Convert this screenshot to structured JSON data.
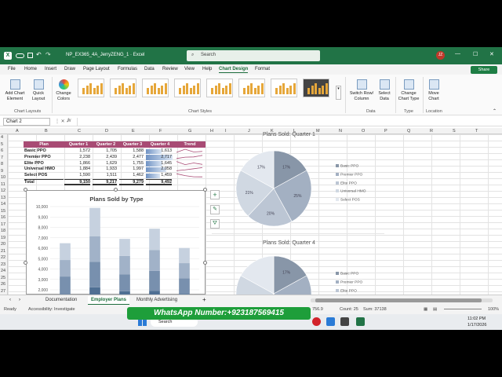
{
  "window": {
    "filename": "NP_EX365_4A_JerryZENG_1 · Excel",
    "search_placeholder": "Search",
    "user_initials": "JZ",
    "share_label": "Share"
  },
  "menu": [
    "File",
    "Home",
    "Insert",
    "Draw",
    "Page Layout",
    "Formulas",
    "Data",
    "Review",
    "View",
    "Help",
    "Chart Design",
    "Format"
  ],
  "menu_active": "Chart Design",
  "ribbon": {
    "add_chart_element": "Add Chart Element",
    "quick_layout": "Quick Layout",
    "change_colors": "Change Colors",
    "chart_layouts_label": "Chart Layouts",
    "chart_styles_label": "Chart Styles",
    "switch_row_col": "Switch Row/ Column",
    "select_data": "Select Data",
    "data_label": "Data",
    "change_chart_type": "Change Chart Type",
    "type_label": "Type",
    "move_chart": "Move Chart",
    "location_label": "Location"
  },
  "formula_bar": {
    "name_box": "Chart 2",
    "fx": "fx",
    "value": ""
  },
  "columns": [
    "A",
    "B",
    "C",
    "D",
    "E",
    "F",
    "G",
    "H",
    "I",
    "J",
    "K",
    "L",
    "M",
    "N",
    "O",
    "P",
    "Q",
    "R",
    "S",
    "T"
  ],
  "rows": [
    "4",
    "5",
    "6",
    "7",
    "8",
    "9",
    "10",
    "11",
    "12",
    "13",
    "14",
    "15",
    "16",
    "17",
    "18",
    "19",
    "20",
    "21",
    "22",
    "23",
    "24",
    "25",
    "26",
    "27"
  ],
  "table": {
    "headers": [
      "Plan",
      "Quarter 1",
      "Quarter 2",
      "Quarter 3",
      "Quarter 4",
      "Trend"
    ],
    "rows": [
      {
        "plan": "Basic PPO",
        "q1": "1,572",
        "q2": "1,705",
        "q3": "1,588",
        "q4": "1,613"
      },
      {
        "plan": "Premier PPO",
        "q1": "2,238",
        "q2": "2,439",
        "q3": "2,477",
        "q4": "2,717"
      },
      {
        "plan": "Elite PPO",
        "q1": "1,866",
        "q2": "1,629",
        "q3": "1,755",
        "q4": "1,645"
      },
      {
        "plan": "Universal HMO",
        "q1": "1,884",
        "q2": "1,933",
        "q3": "1,997",
        "q4": "2,058"
      },
      {
        "plan": "Select POS",
        "q1": "1,590",
        "q2": "1,511",
        "q3": "1,462",
        "q4": "1,459"
      },
      {
        "plan": "Total",
        "q1": "9,150",
        "q2": "9,217",
        "q3": "9,279",
        "q4": "9,492"
      }
    ]
  },
  "chart_data": [
    {
      "type": "bar",
      "stacked": true,
      "title": "Plans Sold by Type",
      "ylim": [
        0,
        10000
      ],
      "yticks": [
        "10,000",
        "9,000",
        "8,000",
        "7,000",
        "6,000",
        "5,000",
        "4,000",
        "3,000",
        "2,000"
      ],
      "series": [
        {
          "values": [
            1572,
            2238,
            1866,
            1884,
            1590
          ]
        },
        {
          "values": [
            1705,
            2439,
            1629,
            1933,
            1511
          ]
        },
        {
          "values": [
            1588,
            2477,
            1755,
            1997,
            1462
          ]
        },
        {
          "values": [
            1613,
            2717,
            1645,
            2058,
            1459
          ]
        }
      ],
      "colors": [
        "#4f6f93",
        "#7890ae",
        "#a1b2c8",
        "#c6d1df"
      ]
    },
    {
      "type": "pie",
      "title": "Plans Sold: Quarter 1",
      "categories": [
        "Basic PPO",
        "Premier PPO",
        "Elite PPO",
        "Universal HMO",
        "Select POS"
      ],
      "values": [
        17,
        25,
        20,
        21,
        17
      ],
      "labels": [
        "17%",
        "25%",
        "20%",
        "21%",
        "17%"
      ]
    },
    {
      "type": "pie",
      "title": "Plans Sold: Quarter 4",
      "categories": [
        "Basic PPO",
        "Premier PPO",
        "Elite PPO"
      ],
      "labels": [
        "17%",
        "15%"
      ]
    }
  ],
  "pie_colors": [
    "#8896a8",
    "#a3b0c2",
    "#bcc6d4",
    "#d0d8e2",
    "#e3e8ef"
  ],
  "sheet_tabs": [
    "Documentation",
    "Employer Plans",
    "Monthly Advertising"
  ],
  "active_tab": "Employer Plans",
  "status": {
    "ready": "Ready",
    "accessibility": "Accessibility: Investigate",
    "average": "756.9",
    "count": "Count: 25",
    "sum": "Sum: 37138",
    "zoom": "100%"
  },
  "taskbar": {
    "search": "Search",
    "time": "11:02 PM",
    "date": "1/17/2026"
  },
  "overlay": {
    "whatsapp": "WhatsApp Number:+923187569415"
  },
  "colors": {
    "excel_green": "#217346",
    "header_pink": "#a84b74"
  }
}
